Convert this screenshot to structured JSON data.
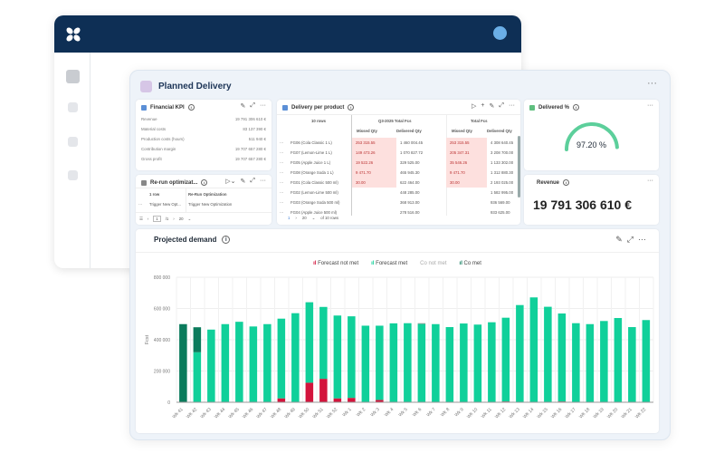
{
  "app": {
    "logo": "x-logo-icon",
    "header_color": "#0e2f55"
  },
  "page": {
    "title": "Planned Delivery"
  },
  "financial_kpi": {
    "title": "Financial KPI",
    "rows": [
      {
        "label": "Revenue",
        "value": "19 791 306 610 €"
      },
      {
        "label": "Material costs",
        "value": "83 137 390 €"
      },
      {
        "label": "Production costs (hours)",
        "value": "511 940 €"
      },
      {
        "label": "Contribution margin",
        "value": "19 707 657 280 €"
      },
      {
        "label": "Gross profit",
        "value": "19 707 657 280 €"
      }
    ]
  },
  "rerun": {
    "title": "Re-run optimizat...",
    "col1": "1 row",
    "col2": "Re-Run Optimization",
    "row": {
      "a": "Trigger New Opt...",
      "b": "Trigger New Optimization"
    },
    "page": "1",
    "pages": "/1",
    "per_page": "20"
  },
  "delivery": {
    "title": "Delivery per product",
    "rows_label": "10 rows",
    "group1": "Q3-2025 Total Fcs",
    "group2": "Total Fcs",
    "sub": [
      "Missed Qty",
      "Delivered Qty",
      "Missed Qty",
      "Delivered Qty"
    ],
    "rows": [
      {
        "name": "FG06 (Cola Classic 1 L)",
        "v": [
          "253 315.55",
          "1 460 004.45",
          "253 315.55",
          "4 308 640.45"
        ]
      },
      {
        "name": "FG07 (Lemon-Lime 1 L)",
        "v": [
          "149 473.26",
          "1 070 827.72",
          "205 347.31",
          "3 208 700.00"
        ]
      },
      {
        "name": "FG05 (Apple Juice 1 L)",
        "v": [
          "19 522.26",
          "329 525.00",
          "35 546.26",
          "1 133 302.00"
        ]
      },
      {
        "name": "FG08 (Orange Soda 1 L)",
        "v": [
          "9 471.70",
          "465 945.30",
          "9 471.70",
          "1 312 880.30"
        ]
      },
      {
        "name": "FG01 (Cola Classic 500 ml)",
        "v": [
          "30.00",
          "622 464.00",
          "30.00",
          "2 193 025.00"
        ]
      },
      {
        "name": "FG02 (Lemon-Lime 500 ml)",
        "v": [
          "",
          "448 285.00",
          "",
          "1 582 995.00"
        ]
      },
      {
        "name": "FG03 (Orange Soda 500 ml)",
        "v": [
          "",
          "368 913.00",
          "",
          "936 569.00"
        ]
      },
      {
        "name": "FG04 (Apple Juice 500 ml)",
        "v": [
          "",
          "278 516.00",
          "",
          "933 625.00"
        ]
      }
    ],
    "page": "1",
    "per_page": "20",
    "total": "of 10 rows"
  },
  "delivered_pct": {
    "title": "Delivered %",
    "value": "97.20 %",
    "fraction": 0.972
  },
  "revenue": {
    "title": "Revenue",
    "value": "19 791 306 610 €"
  },
  "chart_data": {
    "type": "bar",
    "stacked": true,
    "title": "Projected demand",
    "ylabel": "Fcst",
    "ylim": [
      0,
      800000
    ],
    "yticks": [
      "0",
      "200 000",
      "400 000",
      "600 000",
      "800 000"
    ],
    "grid": true,
    "legend": "top",
    "categories": [
      "Wk 41",
      "Wk 42",
      "Wk 43",
      "Wk 44",
      "Wk 45",
      "Wk 46",
      "Wk 47",
      "Wk 48",
      "Wk 49",
      "Wk 50",
      "Wk 51",
      "Wk 52",
      "Wk 1",
      "Wk 2",
      "Wk 3",
      "Wk 4",
      "Wk 5",
      "Wk 6",
      "Wk 7",
      "Wk 8",
      "Wk 9",
      "Wk 10",
      "Wk 11",
      "Wk 12",
      "Wk 13",
      "Wk 14",
      "Wk 15",
      "Wk 16",
      "Wk 17",
      "Wk 18",
      "Wk 19",
      "Wk 20",
      "Wk 21",
      "Wk 22"
    ],
    "series": [
      {
        "name": "Forecast not met",
        "color": "#d3143c",
        "values": [
          0,
          0,
          0,
          0,
          0,
          0,
          0,
          25000,
          0,
          125000,
          150000,
          25000,
          28000,
          0,
          15000,
          0,
          0,
          0,
          0,
          0,
          0,
          0,
          0,
          5000,
          0,
          0,
          0,
          5000,
          0,
          0,
          0,
          0,
          0,
          0
        ]
      },
      {
        "name": "Forecast met",
        "color": "#10d09a",
        "values": [
          0,
          320000,
          465000,
          500000,
          515000,
          485000,
          500000,
          510000,
          570000,
          515000,
          460000,
          530000,
          522000,
          490000,
          475000,
          505000,
          506000,
          501000,
          500000,
          481000,
          504000,
          497000,
          512000,
          536000,
          622000,
          671000,
          611000,
          563000,
          506000,
          500000,
          520000,
          539000,
          481000,
          526000
        ]
      },
      {
        "name": "Co not met",
        "color": "#8a9a95",
        "disabled": true,
        "values": [
          0,
          0,
          0,
          0,
          0,
          0,
          0,
          0,
          0,
          0,
          0,
          0,
          0,
          0,
          0,
          0,
          0,
          5000,
          0,
          0,
          0,
          0,
          0,
          0,
          0,
          0,
          0,
          0,
          0,
          0,
          0,
          0,
          0,
          0
        ]
      },
      {
        "name": "Co met",
        "color": "#0b7b5c",
        "values": [
          500000,
          160000,
          0,
          0,
          0,
          0,
          0,
          0,
          0,
          0,
          0,
          0,
          0,
          0,
          0,
          0,
          0,
          0,
          0,
          0,
          0,
          0,
          0,
          0,
          0,
          0,
          0,
          0,
          0,
          0,
          0,
          0,
          0,
          0
        ]
      }
    ]
  }
}
